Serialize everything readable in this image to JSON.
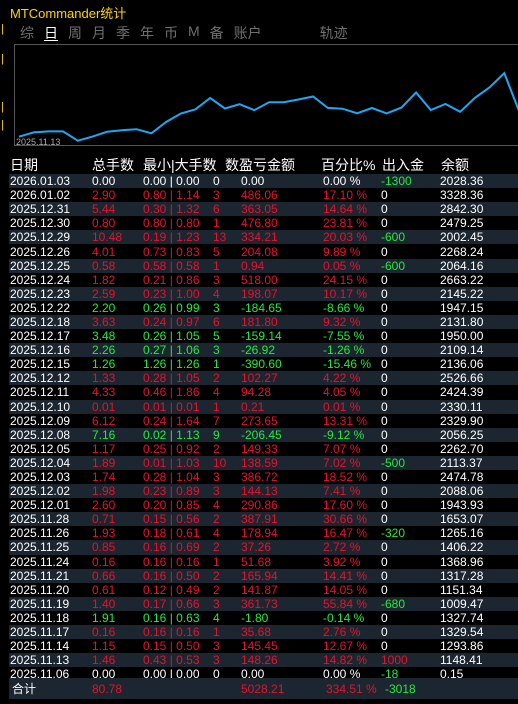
{
  "window": {
    "title": "MTCommander统计"
  },
  "tabs": [
    {
      "label": "综",
      "active": false
    },
    {
      "label": "日",
      "active": true
    },
    {
      "label": "周",
      "active": false
    },
    {
      "label": "月",
      "active": false
    },
    {
      "label": "季",
      "active": false
    },
    {
      "label": "年",
      "active": false
    },
    {
      "label": "币",
      "active": false
    },
    {
      "label": "M",
      "active": false
    },
    {
      "label": "备",
      "active": false
    },
    {
      "label": "账户",
      "active": false
    },
    {
      "label": "轨迹",
      "active": false
    }
  ],
  "chart_data": {
    "type": "line",
    "x": [
      "2025.11.06",
      "2025.11.13",
      "2025.11.14",
      "2025.11.17",
      "2025.11.18",
      "2025.11.19",
      "2025.11.20",
      "2025.11.21",
      "2025.11.24",
      "2025.11.25",
      "2025.11.26",
      "2025.11.28",
      "2025.12.01",
      "2025.12.02",
      "2025.12.03",
      "2025.12.04",
      "2025.12.05",
      "2025.12.08",
      "2025.12.09",
      "2025.12.10",
      "2025.12.11",
      "2025.12.12",
      "2025.12.15",
      "2025.12.16",
      "2025.12.17",
      "2025.12.18",
      "2025.12.22",
      "2025.12.23",
      "2025.12.24",
      "2025.12.25",
      "2025.12.26",
      "2025.12.29",
      "2025.12.30",
      "2025.12.31",
      "2026.01.02",
      "2026.01.03"
    ],
    "values": [
      0.15,
      1148.41,
      1293.86,
      1329.54,
      1327.74,
      1009.47,
      1151.34,
      1317.28,
      1368.96,
      1406.22,
      1265.16,
      1653.07,
      1943.93,
      2088.06,
      2474.78,
      2113.37,
      2262.7,
      2056.25,
      2329.9,
      2330.11,
      2424.39,
      2526.66,
      2136.06,
      2109.14,
      1950.0,
      2131.8,
      1947.15,
      2145.22,
      2663.22,
      2064.16,
      2268.24,
      2002.45,
      2479.25,
      2842.3,
      3328.36,
      2028.36
    ],
    "xlabel_start": "2025.11.13",
    "line_color": "#1ea7f2"
  },
  "table": {
    "headers": [
      "日期",
      "总手数",
      "最小|大手数",
      "数",
      "盈亏金额",
      "百分比%",
      "出入金",
      "余额"
    ],
    "rows": [
      {
        "date": "2026.01.03",
        "lots": "0.00",
        "minmax": "0.00 | 0.00",
        "count": "0",
        "pnl": "0.00",
        "pct": "0.00 %",
        "flow": "-1300",
        "balance": "2028.36",
        "tone": "white"
      },
      {
        "date": "2026.01.02",
        "lots": "2.90",
        "minmax": "0.80 | 1.14",
        "count": "3",
        "pnl": "486.06",
        "pct": "17.10 %",
        "flow": "0",
        "balance": "3328.36",
        "tone": "red"
      },
      {
        "date": "2025.12.31",
        "lots": "5.44",
        "minmax": "0.30 | 1.32",
        "count": "6",
        "pnl": "363.05",
        "pct": "14.64 %",
        "flow": "0",
        "balance": "2842.30",
        "tone": "red"
      },
      {
        "date": "2025.12.30",
        "lots": "0.80",
        "minmax": "0.80 | 0.80",
        "count": "1",
        "pnl": "476.80",
        "pct": "23.81 %",
        "flow": "0",
        "balance": "2479.25",
        "tone": "red"
      },
      {
        "date": "2025.12.29",
        "lots": "10.48",
        "minmax": "0.19 | 1.23",
        "count": "13",
        "pnl": "334.21",
        "pct": "20.03 %",
        "flow": "-600",
        "balance": "2002.45",
        "tone": "red"
      },
      {
        "date": "2025.12.26",
        "lots": "4.01",
        "minmax": "0.73 | 0.83",
        "count": "5",
        "pnl": "204.08",
        "pct": "9.89 %",
        "flow": "0",
        "balance": "2268.24",
        "tone": "red"
      },
      {
        "date": "2025.12.25",
        "lots": "0.58",
        "minmax": "0.58 | 0.58",
        "count": "1",
        "pnl": "0.94",
        "pct": "0.05 %",
        "flow": "-600",
        "balance": "2064.16",
        "tone": "red"
      },
      {
        "date": "2025.12.24",
        "lots": "1.82",
        "minmax": "0.21 | 0.86",
        "count": "3",
        "pnl": "518.00",
        "pct": "24.15 %",
        "flow": "0",
        "balance": "2663.22",
        "tone": "red"
      },
      {
        "date": "2025.12.23",
        "lots": "2.59",
        "minmax": "0.23 | 1.00",
        "count": "4",
        "pnl": "198.07",
        "pct": "10.17 %",
        "flow": "0",
        "balance": "2145.22",
        "tone": "red"
      },
      {
        "date": "2025.12.22",
        "lots": "2.20",
        "minmax": "0.26 | 0.99",
        "count": "3",
        "pnl": "-184.65",
        "pct": "-8.66 %",
        "flow": "0",
        "balance": "1947.15",
        "tone": "green"
      },
      {
        "date": "2025.12.18",
        "lots": "3.63",
        "minmax": "0.24 | 0.97",
        "count": "6",
        "pnl": "181.80",
        "pct": "9.32 %",
        "flow": "0",
        "balance": "2131.80",
        "tone": "red"
      },
      {
        "date": "2025.12.17",
        "lots": "3.48",
        "minmax": "0.26 | 1.05",
        "count": "5",
        "pnl": "-159.14",
        "pct": "-7.55 %",
        "flow": "0",
        "balance": "1950.00",
        "tone": "green"
      },
      {
        "date": "2025.12.16",
        "lots": "2.26",
        "minmax": "0.27 | 1.06",
        "count": "3",
        "pnl": "-26.92",
        "pct": "-1.26 %",
        "flow": "0",
        "balance": "2109.14",
        "tone": "green"
      },
      {
        "date": "2025.12.15",
        "lots": "1.26",
        "minmax": "1.26 | 1.26",
        "count": "1",
        "pnl": "-390.60",
        "pct": "-15.46 %",
        "flow": "0",
        "balance": "2136.06",
        "tone": "green"
      },
      {
        "date": "2025.12.12",
        "lots": "1.33",
        "minmax": "0.28 | 1.05",
        "count": "2",
        "pnl": "102.27",
        "pct": "4.22 %",
        "flow": "0",
        "balance": "2526.66",
        "tone": "red"
      },
      {
        "date": "2025.12.11",
        "lots": "4.33",
        "minmax": "0.46 | 1.86",
        "count": "4",
        "pnl": "94.28",
        "pct": "4.05 %",
        "flow": "0",
        "balance": "2424.39",
        "tone": "red"
      },
      {
        "date": "2025.12.10",
        "lots": "0.01",
        "minmax": "0.01 | 0.01",
        "count": "1",
        "pnl": "0.21",
        "pct": "0.01 %",
        "flow": "0",
        "balance": "2330.11",
        "tone": "red"
      },
      {
        "date": "2025.12.09",
        "lots": "6.12",
        "minmax": "0.24 | 1.64",
        "count": "7",
        "pnl": "273.65",
        "pct": "13.31 %",
        "flow": "0",
        "balance": "2329.90",
        "tone": "red"
      },
      {
        "date": "2025.12.08",
        "lots": "7.16",
        "minmax": "0.02 | 1.13",
        "count": "9",
        "pnl": "-206.45",
        "pct": "-9.12 %",
        "flow": "0",
        "balance": "2056.25",
        "tone": "green"
      },
      {
        "date": "2025.12.05",
        "lots": "1.17",
        "minmax": "0.25 | 0.92",
        "count": "2",
        "pnl": "149.33",
        "pct": "7.07 %",
        "flow": "0",
        "balance": "2262.70",
        "tone": "red"
      },
      {
        "date": "2025.12.04",
        "lots": "1.89",
        "minmax": "0.01 | 1.03",
        "count": "10",
        "pnl": "138.59",
        "pct": "7.02 %",
        "flow": "-500",
        "balance": "2113.37",
        "tone": "red"
      },
      {
        "date": "2025.12.03",
        "lots": "1.74",
        "minmax": "0.28 | 1.04",
        "count": "3",
        "pnl": "386.72",
        "pct": "18.52 %",
        "flow": "0",
        "balance": "2474.78",
        "tone": "red"
      },
      {
        "date": "2025.12.02",
        "lots": "1.98",
        "minmax": "0.23 | 0.89",
        "count": "3",
        "pnl": "144.13",
        "pct": "7.41 %",
        "flow": "0",
        "balance": "2088.06",
        "tone": "red"
      },
      {
        "date": "2025.12.01",
        "lots": "2.60",
        "minmax": "0.20 | 0.85",
        "count": "4",
        "pnl": "290.86",
        "pct": "17.60 %",
        "flow": "0",
        "balance": "1943.93",
        "tone": "red"
      },
      {
        "date": "2025.11.28",
        "lots": "0.71",
        "minmax": "0.15 | 0.56",
        "count": "2",
        "pnl": "387.91",
        "pct": "30.66 %",
        "flow": "0",
        "balance": "1653.07",
        "tone": "red"
      },
      {
        "date": "2025.11.26",
        "lots": "1.93",
        "minmax": "0.18 | 0.61",
        "count": "4",
        "pnl": "178.94",
        "pct": "16.47 %",
        "flow": "-320",
        "balance": "1265.16",
        "tone": "red"
      },
      {
        "date": "2025.11.25",
        "lots": "0.85",
        "minmax": "0.16 | 0.69",
        "count": "2",
        "pnl": "37.26",
        "pct": "2.72 %",
        "flow": "0",
        "balance": "1406.22",
        "tone": "red"
      },
      {
        "date": "2025.11.24",
        "lots": "0.16",
        "minmax": "0.16 | 0.16",
        "count": "1",
        "pnl": "51.68",
        "pct": "3.92 %",
        "flow": "0",
        "balance": "1368.96",
        "tone": "red"
      },
      {
        "date": "2025.11.21",
        "lots": "0.66",
        "minmax": "0.16 | 0.50",
        "count": "2",
        "pnl": "165.94",
        "pct": "14.41 %",
        "flow": "0",
        "balance": "1317.28",
        "tone": "red"
      },
      {
        "date": "2025.11.20",
        "lots": "0.61",
        "minmax": "0.12 | 0.49",
        "count": "2",
        "pnl": "141.87",
        "pct": "14.05 %",
        "flow": "0",
        "balance": "1151.34",
        "tone": "red"
      },
      {
        "date": "2025.11.19",
        "lots": "1.40",
        "minmax": "0.17 | 0.66",
        "count": "3",
        "pnl": "361.73",
        "pct": "55.84 %",
        "flow": "-680",
        "balance": "1009.47",
        "tone": "red"
      },
      {
        "date": "2025.11.18",
        "lots": "1.91",
        "minmax": "0.16 | 0.63",
        "count": "4",
        "pnl": "-1.80",
        "pct": "-0.14 %",
        "flow": "0",
        "balance": "1327.74",
        "tone": "green"
      },
      {
        "date": "2025.11.17",
        "lots": "0.16",
        "minmax": "0.16 | 0.16",
        "count": "1",
        "pnl": "35.68",
        "pct": "2.76 %",
        "flow": "0",
        "balance": "1329.54",
        "tone": "red"
      },
      {
        "date": "2025.11.14",
        "lots": "1.15",
        "minmax": "0.15 | 0.50",
        "count": "3",
        "pnl": "145.45",
        "pct": "12.67 %",
        "flow": "0",
        "balance": "1293.86",
        "tone": "red"
      },
      {
        "date": "2025.11.13",
        "lots": "1.46",
        "minmax": "0.43 | 0.53",
        "count": "3",
        "pnl": "148.26",
        "pct": "14.82 %",
        "flow": "1000",
        "balance": "1148.41",
        "tone": "red",
        "flow_tone": "red"
      },
      {
        "date": "2025.11.06",
        "lots": "0.00",
        "minmax": "0.00 | 0.00",
        "count": "0",
        "pnl": "0.00",
        "pct": "0.00 %",
        "flow": "-18",
        "balance": "0.15",
        "tone": "white"
      }
    ],
    "total": {
      "label": "合计",
      "lots": "80.78",
      "pnl": "5028.21",
      "pct": "334.51 %",
      "flow": "-3018"
    }
  },
  "colors": {
    "profit": "#e8112d",
    "loss": "#26e840",
    "deposit": "#26e840",
    "title": "#ffd400",
    "row_alt": "#1c2630"
  }
}
